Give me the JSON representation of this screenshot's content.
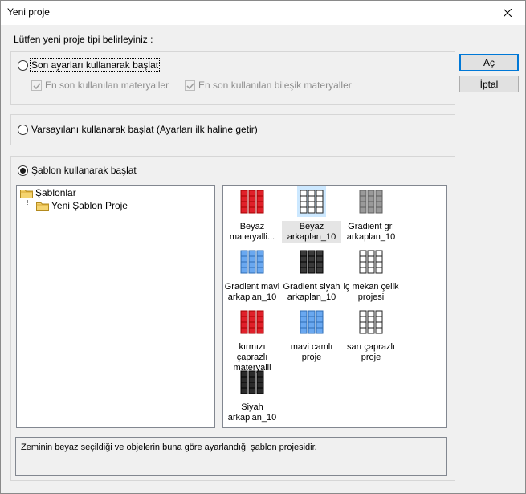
{
  "window": {
    "title": "Yeni proje"
  },
  "prompt": "Lütfen yeni proje tipi belirleyiniz :",
  "options": {
    "last_settings": {
      "label": "Son ayarları kullanarak başlat",
      "recent_materials": "En son kullanılan materyaller",
      "recent_composite": "En son kullanılan bileşik materyaller"
    },
    "default_settings": {
      "label": "Varsayılanı kullanarak başlat (Ayarları ilk haline getir)"
    },
    "template": {
      "label": "Şablon kullanarak başlat"
    }
  },
  "buttons": {
    "ok": "Aç",
    "cancel": "İptal"
  },
  "tree": {
    "root": "Şablonlar",
    "child": "Yeni Şablon Proje"
  },
  "templates": [
    {
      "line1": "Beyaz",
      "line2": "materyalli...",
      "color": "#e0202a"
    },
    {
      "line1": "Beyaz",
      "line2": "arkaplan_10",
      "color": "#ffffff"
    },
    {
      "line1": "Gradient gri",
      "line2": "arkaplan_10",
      "color": "#9a9a9a"
    },
    {
      "line1": "Gradient mavi",
      "line2": "arkaplan_10",
      "color": "#6aa8f0"
    },
    {
      "line1": "Gradient siyah",
      "line2": "arkaplan_10",
      "color": "#3a3a3a"
    },
    {
      "line1": "iç mekan çelik",
      "line2": "projesi",
      "color": "#ffffff"
    },
    {
      "line1": "kırmızı çaprazlı",
      "line2": "materyalli",
      "color": "#e0202a"
    },
    {
      "line1": "mavi camlı",
      "line2": "proje",
      "color": "#6aa8f0"
    },
    {
      "line1": "sarı çaprazlı",
      "line2": "proje",
      "color": "#ffffff"
    },
    {
      "line1": "Siyah",
      "line2": "arkaplan_10",
      "color": "#2a2a2a"
    }
  ],
  "description": "Zeminin beyaz seçildiği ve objelerin buna göre ayarlandığı şablon projesidir."
}
